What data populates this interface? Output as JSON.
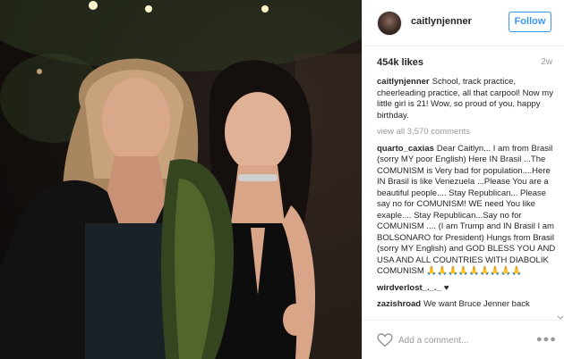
{
  "post": {
    "username": "caitlynjenner",
    "follow_label": "Follow",
    "likes": "454k likes",
    "timestamp": "2w"
  },
  "caption": {
    "author": "caitlynjenner",
    "text": "School, track practice, cheerleading practice, all that carpool! Now my little girl is 21! Wow, so proud of you, happy birthday."
  },
  "view_all_label": "view all 3,570 comments",
  "comments": [
    {
      "author": "quarto_caxias",
      "text": "Dear Caitlyn... I am from Brasil (sorry MY poor English) Here IN Brasil ...The COMUNISM is Very bad for population....Here IN Brasil is like Venezuela ...Please You are a beautiful people.... Stay Republican... Please say no for COMUNISM! WE need You like exaple.... Stay Republican...Say no for COMUNISM .... (I am Trump and IN Brasil I am BOLSONARO for President) Hungs from Brasil (sorry MY English) and GOD BLESS YOU AND USA AND ALL COUNTRIES WITH DIABOLIK COMUNISM 🙏🙏🙏🙏🙏🙏🙏🙏🙏"
    },
    {
      "author": "wirdverlost_._._",
      "text": "♥"
    },
    {
      "author": "zazishroad",
      "text": "We want Bruce Jenner back"
    }
  ],
  "add_comment": {
    "placeholder": "Add a comment..."
  },
  "icons": {
    "like": "heart-outline-icon",
    "options": "more-options-icon"
  },
  "colors": {
    "accent": "#3897f0",
    "text": "#262626",
    "muted": "#999999",
    "border": "#efefef"
  }
}
